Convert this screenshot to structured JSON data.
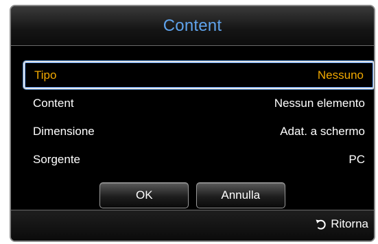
{
  "dialog": {
    "title": "Content",
    "rows": [
      {
        "label": "Tipo",
        "value": "Nessuno"
      },
      {
        "label": "Content",
        "value": "Nessun elemento"
      },
      {
        "label": "Dimensione",
        "value": "Adat. a schermo"
      },
      {
        "label": "Sorgente",
        "value": "PC"
      }
    ],
    "buttons": {
      "ok": "OK",
      "cancel": "Annulla"
    },
    "footer": {
      "return_label": "Ritorna",
      "return_icon": "return-arrow-icon"
    }
  },
  "colors": {
    "title": "#5fa3ec",
    "selected_text": "#f2a900",
    "text": "#ffffff",
    "background": "#000000"
  }
}
